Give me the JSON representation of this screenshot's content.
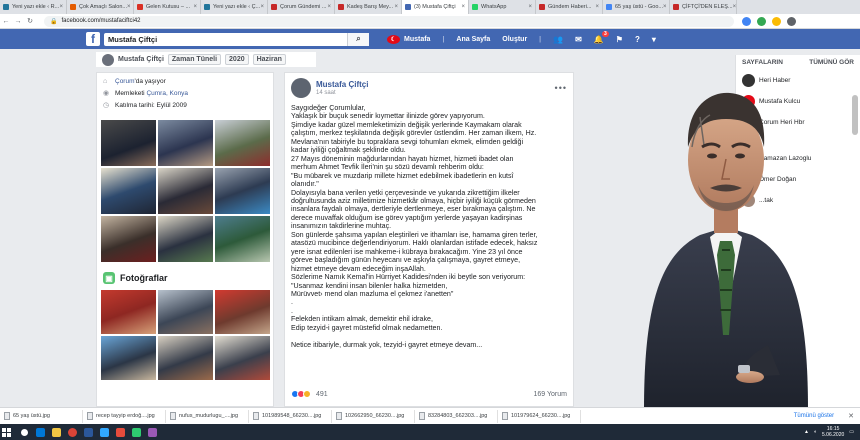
{
  "browser": {
    "tabs": [
      {
        "label": "Yeni yazı ekle ‹ R...",
        "color": "#21759b",
        "active": false
      },
      {
        "label": "Çok Amaçlı Salon...",
        "color": "#e45c00",
        "active": false
      },
      {
        "label": "Gelen Kutusu – ...",
        "color": "#d93025",
        "active": false
      },
      {
        "label": "Yeni yazı ekle ‹ Ç...",
        "color": "#21759b",
        "active": false
      },
      {
        "label": "Çorum Gündemi ...",
        "color": "#c62828",
        "active": false
      },
      {
        "label": "Kadeş Barış Mey...",
        "color": "#c62828",
        "active": false
      },
      {
        "label": "(3) Mustafa Çiftçi",
        "color": "#4267b2",
        "active": true
      },
      {
        "label": "WhatsApp",
        "color": "#25d366",
        "active": false
      },
      {
        "label": "Gündem Haberi...",
        "color": "#c62828",
        "active": false
      },
      {
        "label": "65 yaş üstü - Goo...",
        "color": "#4285f4",
        "active": false
      },
      {
        "label": "ÇİFTÇİ'DEN ELEŞ...",
        "color": "#c62828",
        "active": false
      }
    ],
    "url": "facebook.com/mustafaciftci42"
  },
  "fb": {
    "logo": "f",
    "search_value": "Mustafa Çiftçi",
    "user_name": "Mustafa",
    "nav_home": "Ana Sayfa",
    "nav_create": "Oluştur",
    "notif_count": "3"
  },
  "subheader": {
    "name": "Mustafa Çiftçi",
    "timeline": "Zaman Tüneli",
    "year": "2020",
    "month": "Haziran"
  },
  "intro": {
    "lives_prefix": "Çorum",
    "lives_suffix": "'da yaşıyor",
    "hometown_prefix": "Memleketi ",
    "hometown_link": "Çumra, Konya",
    "joined": "Katılma tarihi: Eylül 2009"
  },
  "photos_title": "Fotoğraflar",
  "post": {
    "author": "Mustafa Çiftçi",
    "time": "14 saat",
    "text": "Saygıdeğer Çorumlular,\nYaklaşık bir buçuk senedir kıymettar ilinizde görev yapıyorum.\nŞimdiye kadar güzel memleketimizin değişik yerlerinde Kaymakam olarak\nçalıştım, merkez teşkilatında değişik görevler üstlendim. Her zaman ilkem, Hz.\nMevlana'nın tabiriyle bu topraklara sevgi tohumları ekmek, elimden geldiği\nkadar iyiliği çoğaltmak şeklinde oldu.\n27 Mayıs döneminin mağdurlarından hayatı hizmet, hizmeti ibadet olan\nmerhum Ahmet Tevfik İleri'nin şu sözü devamlı rehberim oldu:\n\"Bu mübarek ve muzdarip millete hizmet edebilmek ibadetlerin en kutsî\nolanıdır.\"\nDolayısıyla bana verilen yetki çerçevesinde ve yukarıda zikrettiğim ilkeler\ndoğrultusunda aziz milletimize hizmetkâr olmaya, hiçbir iyiliği küçük görmeden\ninsanlara faydalı olmaya, dertleriyle dertlenmeye, eser bırakmaya çalıştım. Ne\nderece muvaffak olduğum ise görev yaptığım yerlerde yaşayan kadirşinas\ninsanımızın takdirlerine muhtaç.\nSon günlerde şahsıma yapılan eleştirileri ve ithamları ise, hamama giren terler,\natasözü mucibince değerlendiriyorum. Haklı olanlardan istifade edecek, haksız\nyere isnat edilenleri ise mahkeme-i kübraya bırakacağım. Yine 23 yıl önce\ngöreve başladığım günün heyecanı ve aşkıyla çalışmaya, gayret etmeye,\nhizmet etmeye devam edeceğim inşaAllah.\nSözlerime Namık Kemal'in Hürriyet Kadidesi'nden iki beytle son veriyorum:\n\"Usanmaz kendini insan bilenler halka hizmetden,\nMürüvvet› mend olan mazluma el çekmez i'anetten\"\n.\n.\nFelekden intikam almak, demektir ehil idrake,\nEdip tezyid-i gayret müstefid olmak nedametten.\n\nNetice itibariyle, durmak yok, tezyid-i gayret etmeye devam...",
    "reaction_count": "491",
    "comments": "169 Yorum"
  },
  "sidebar": {
    "pages_title": "SAYFALARIN",
    "see_all": "TÜMÜNÜ GÖR",
    "pages": [
      {
        "name": "Heri Haber",
        "color": "#333333"
      },
      {
        "name": "Mustafa Kulcu",
        "color": "#e30a17"
      },
      {
        "name": "Çorum Heri Hbr",
        "color": "#555555"
      }
    ],
    "people_title": "LER",
    "people": [
      {
        "name": "Ramazan Lazoglu",
        "color": "#8a6d5a"
      },
      {
        "name": "Ömer Doğan",
        "color": "#7b8794"
      },
      {
        "name": "...tak",
        "color": "#a0877a"
      }
    ]
  },
  "downloads": {
    "items": [
      "65 yaş üstü.jpg",
      "recep tayyip erdoğ....jpg",
      "nufus_mudurlugu_....jpg",
      "101989548_66230....jpg",
      "102662950_66230....jpg",
      "83284803_662303....jpg",
      "101979624_66230....jpg"
    ],
    "show_all": "Tümünü göster"
  },
  "taskbar": {
    "time": "16:15",
    "date": "5.06.2020"
  }
}
